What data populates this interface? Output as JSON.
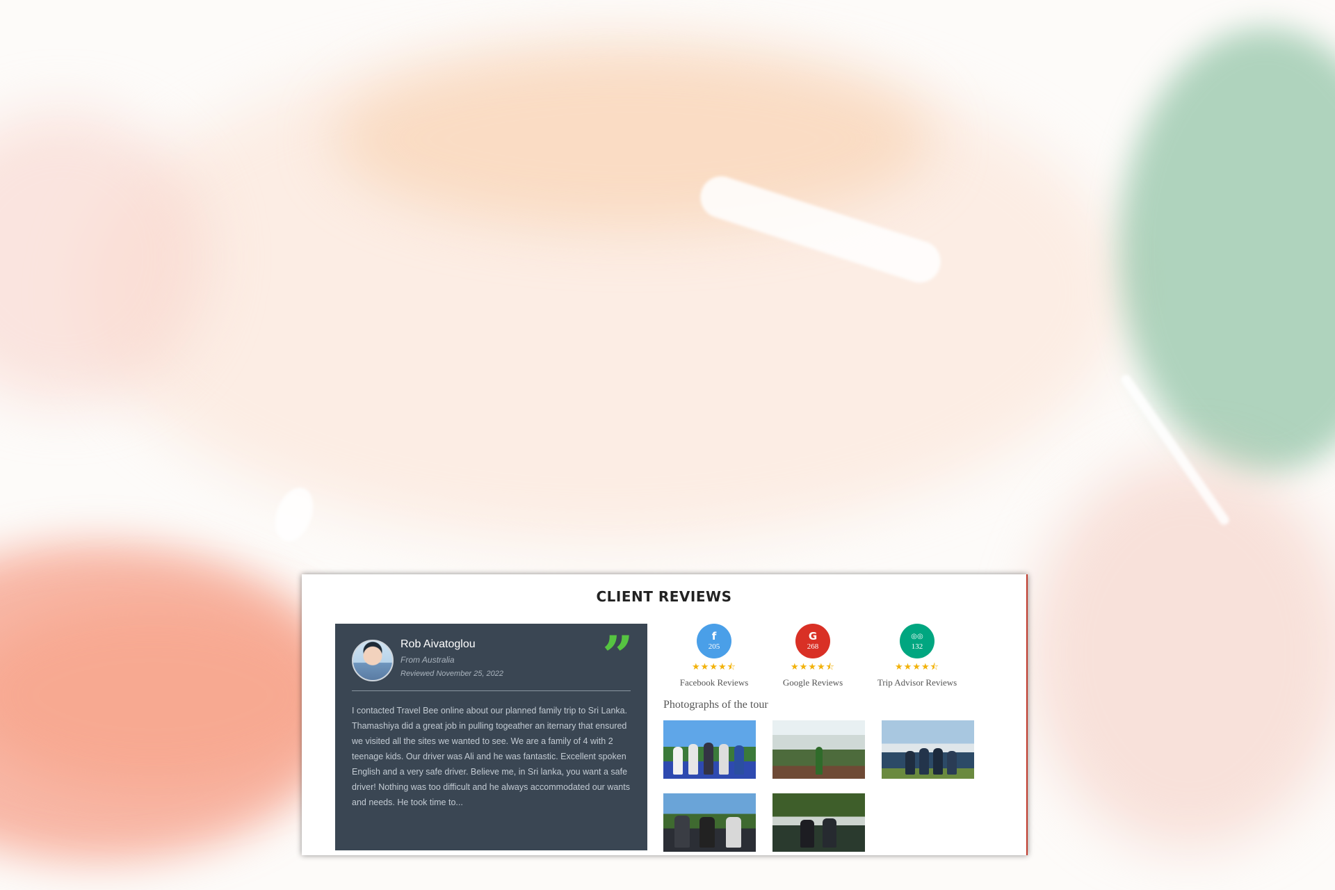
{
  "section": {
    "title": "CLIENT REVIEWS"
  },
  "review": {
    "name": "Rob Aivatoglou",
    "from": "From Australia",
    "date": "Reviewed November 25, 2022",
    "quote_icon": "quote-icon",
    "text": "I contacted Travel Bee online about our planned family trip to Sri Lanka. Thamashiya did a great job in pulling togeather an iternary that ensured we visited all the sites we wanted to see. We are a family of 4 with 2 teenage kids. Our driver was Ali and he was fantastic. Excellent spoken English and a very safe driver. Believe me, in Sri lanka, you want a safe driver! Nothing was too difficult and he always accommodated our wants and needs. He took time to..."
  },
  "stats": [
    {
      "icon": "facebook-icon",
      "glyph": "f",
      "count": "205",
      "label": "Facebook Reviews",
      "color": "#4a9fe8",
      "rating": 4.5
    },
    {
      "icon": "google-icon",
      "glyph": "G",
      "count": "268",
      "label": "Google Reviews",
      "color": "#d93025",
      "rating": 4.5
    },
    {
      "icon": "tripadvisor-icon",
      "glyph": "◎◎",
      "count": "132",
      "label": "Trip Advisor Reviews",
      "color": "#00a680",
      "rating": 4.5
    }
  ],
  "stars_text": "★★★★⯪",
  "photos": {
    "title": "Photographs of the tour",
    "count": 5
  },
  "colors": {
    "panel": "#3a4653",
    "quote": "#56c441",
    "star": "#f2b20a"
  }
}
